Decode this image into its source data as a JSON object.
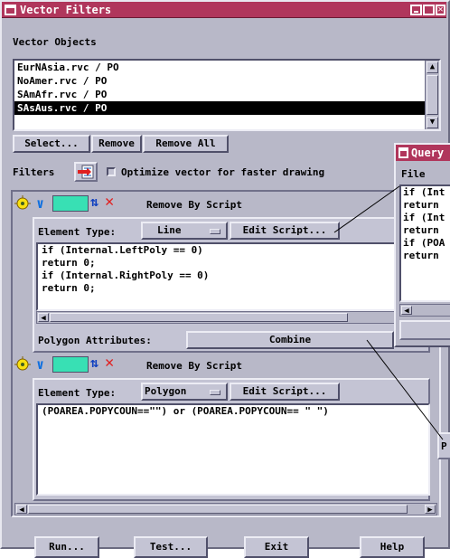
{
  "window": {
    "title": "Vector Filters"
  },
  "vector_objects": {
    "heading": "Vector Objects",
    "items": [
      {
        "label": "EurNAsia.rvc / PO",
        "selected": false
      },
      {
        "label": "NoAmer.rvc / PO",
        "selected": false
      },
      {
        "label": "SAmAfr.rvc / PO",
        "selected": false
      },
      {
        "label": "SAsAus.rvc / PO",
        "selected": true
      }
    ],
    "select_label": "Select...",
    "remove_label": "Remove",
    "remove_all_label": "Remove All"
  },
  "filters": {
    "label": "Filters",
    "optimize_label": "Optimize vector for faster drawing",
    "optimize_checked": false
  },
  "filter1": {
    "title": "Remove By Script",
    "element_type_label": "Element Type:",
    "element_type_value": "Line",
    "edit_script_label": "Edit Script...",
    "script_lines": [
      "if (Internal.LeftPoly == 0)",
      "return 0;",
      "if (Internal.RightPoly == 0)",
      "return 0;"
    ],
    "polygon_attributes_label": "Polygon Attributes:",
    "polygon_attributes_value": "Combine",
    "swatch_color": "#38e0b4"
  },
  "filter2": {
    "title": "Remove By Script",
    "element_type_label": "Element Type:",
    "element_type_value": "Polygon",
    "edit_script_label": "Edit Script...",
    "script_text": "(POAREA.POPYCOUN==\"\") or (POAREA.POPYCOUN== \" \")",
    "swatch_color": "#38e0b4"
  },
  "footer": {
    "run_label": "Run...",
    "test_label": "Test...",
    "exit_label": "Exit",
    "help_label": "Help"
  },
  "query_window": {
    "title": "Query",
    "menu_file": "File",
    "lines": [
      "if (Int",
      "return",
      "if (Int",
      "return",
      "if (POA",
      "return"
    ],
    "bottom_button_label": "P"
  },
  "colors": {
    "title_bar": "#b0365c",
    "window_bg": "#b8b8c8",
    "filter_icon_check": "#1080e0",
    "remove_x": "#e02020"
  }
}
